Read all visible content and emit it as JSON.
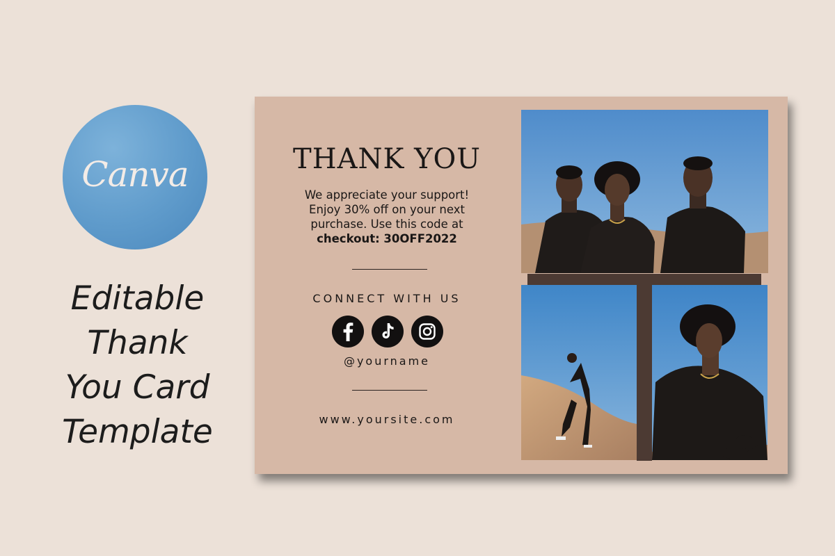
{
  "badge": {
    "logo_text": "Canva"
  },
  "caption": {
    "lines": [
      "Editable",
      "Thank",
      "You Card",
      "Template"
    ]
  },
  "card": {
    "title": "THANK YOU",
    "message": [
      "We appreciate your support!",
      "Enjoy 30% off on your next",
      "purchase. Use this code at",
      "checkout: 30OFF2022"
    ],
    "connect": "CONNECT WITH US",
    "socials": [
      "facebook-icon",
      "tiktok-icon",
      "instagram-icon"
    ],
    "handle": "@yourname",
    "website": "www.yoursite.com"
  },
  "colors": {
    "background": "#ece1d8",
    "card": "#d6b8a6",
    "accent_brown": "#4c3a33",
    "badge_blue": "#5f9bcb",
    "text": "#1a1716"
  }
}
